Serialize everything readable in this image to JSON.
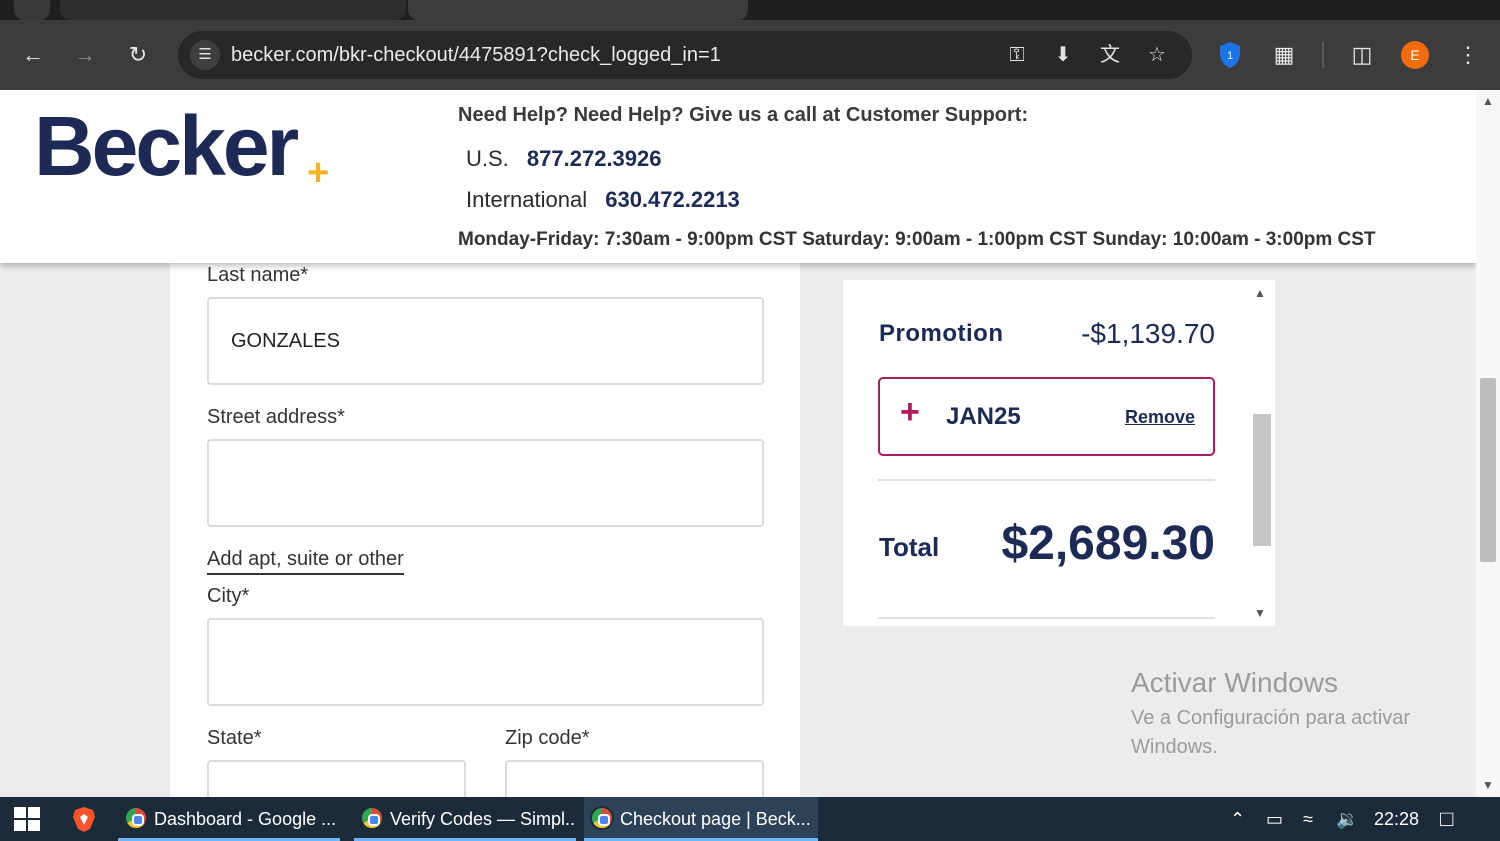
{
  "browser": {
    "url": "becker.com/bkr-checkout/4475891?check_logged_in=1",
    "profile_initial": "E",
    "extension_badge": "1"
  },
  "header": {
    "logo": "Becker",
    "help_line": "Need Help? Need Help? Give us a call at Customer Support:",
    "us_label": "U.S.",
    "us_phone": "877.272.3926",
    "intl_label": "International",
    "intl_phone": "630.472.2213",
    "hours": "Monday-Friday: 7:30am - 9:00pm CST Saturday: 9:00am - 1:00pm CST Sunday: 10:00am - 3:00pm CST"
  },
  "form": {
    "last_name_label": "Last name*",
    "last_name_value": "GONZALES",
    "street_label": "Street address*",
    "street_value": "",
    "apt_link": "Add apt, suite or other",
    "city_label": "City*",
    "city_value": "",
    "state_label": "State*",
    "zip_label": "Zip code*"
  },
  "summary": {
    "promotion_label": "Promotion",
    "promotion_value": "-$1,139.70",
    "promo_code": "JAN25",
    "remove_label": "Remove",
    "total_label": "Total",
    "total_value": "$2,689.30"
  },
  "watermark": {
    "title": "Activar Windows",
    "subtitle": "Ve a Configuración para activar Windows."
  },
  "taskbar": {
    "tasks": [
      {
        "label": "Dashboard - Google ..."
      },
      {
        "label": "Verify Codes — Simpl..."
      },
      {
        "label": "Checkout page | Beck..."
      }
    ],
    "time": "22:28"
  },
  "colors": {
    "brand_navy": "#1c2a55",
    "brand_gold": "#f5b324",
    "promo_accent": "#b3195d"
  }
}
